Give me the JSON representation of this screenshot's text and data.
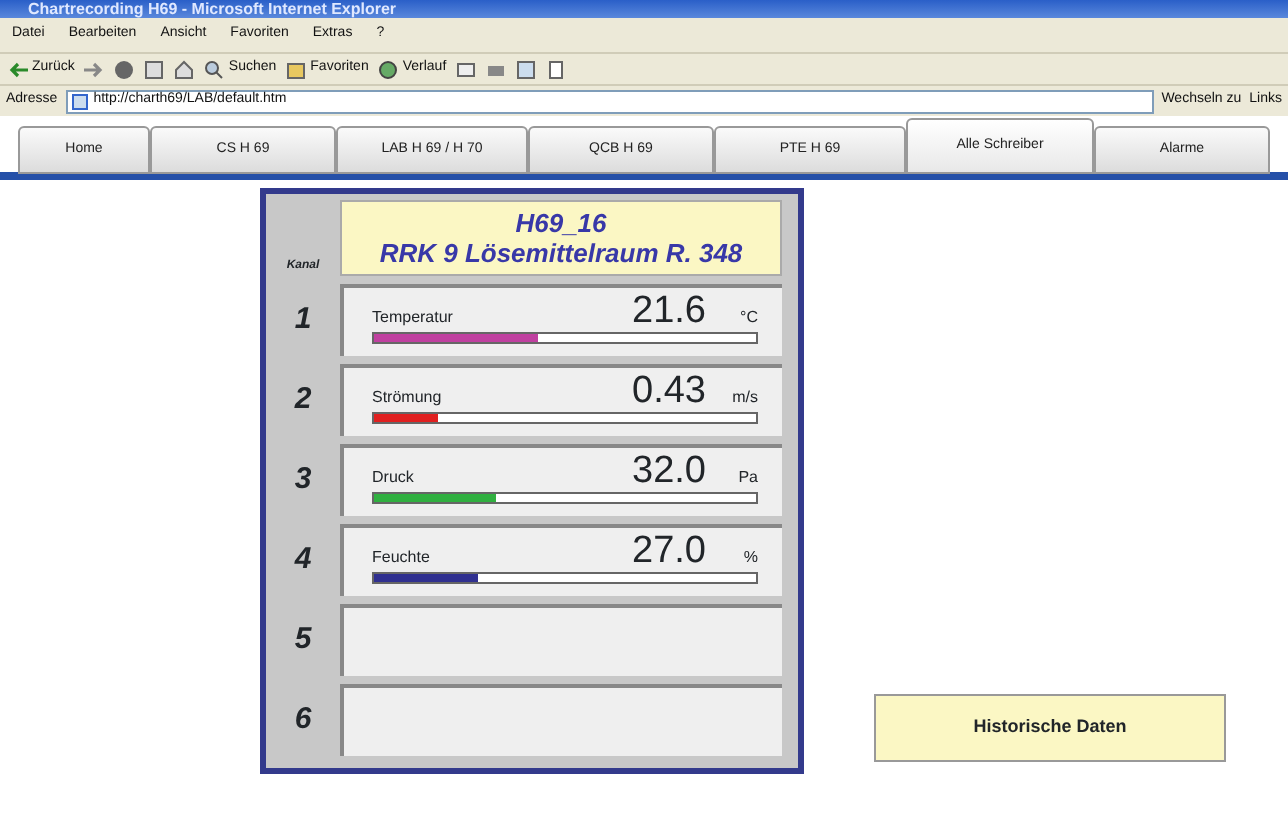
{
  "window": {
    "title": "Chartrecording H69 - Microsoft Internet Explorer"
  },
  "menu": [
    "Datei",
    "Bearbeiten",
    "Ansicht",
    "Favoriten",
    "Extras",
    "?"
  ],
  "toolbar": [
    {
      "kind": "back",
      "label": "Zurück"
    },
    {
      "kind": "forward"
    },
    {
      "kind": "stop"
    },
    {
      "kind": "refresh"
    },
    {
      "kind": "home"
    },
    {
      "kind": "search",
      "label": "Suchen"
    },
    {
      "kind": "favorites",
      "label": "Favoriten"
    },
    {
      "kind": "history",
      "label": "Verlauf"
    },
    {
      "kind": "mail"
    },
    {
      "kind": "print"
    },
    {
      "kind": "edit"
    },
    {
      "kind": "discuss"
    }
  ],
  "address": {
    "label": "Adresse",
    "value": "http://charth69/LAB/default.htm",
    "go": "Wechseln zu",
    "links": "Links"
  },
  "tabs": [
    {
      "label": "Home",
      "selected": false
    },
    {
      "label": "CS H 69",
      "selected": false
    },
    {
      "label": "LAB H 69 / H 70",
      "selected": false
    },
    {
      "label": "QCB H 69",
      "selected": false
    },
    {
      "label": "PTE H 69",
      "selected": false
    },
    {
      "label": "Alle Schreiber",
      "selected": true
    },
    {
      "label": "Alarme",
      "selected": false
    }
  ],
  "panel": {
    "title": "H69_16",
    "subtitle": "RRK 9 Lösemittelraum R. 348",
    "channel_label": "Kanal",
    "channels": [
      {
        "number": "1",
        "name": "Temperatur",
        "value": "21.6",
        "unit": "°C",
        "level": 0.43,
        "color": "#c040a0"
      },
      {
        "number": "2",
        "name": "Strömung",
        "value": "0.43",
        "unit": "m/s",
        "level": 0.17,
        "color": "#e02020"
      },
      {
        "number": "3",
        "name": "Druck",
        "value": "32.0",
        "unit": "Pa",
        "level": 0.32,
        "color": "#30b040"
      },
      {
        "number": "4",
        "name": "Feuchte",
        "value": "27.0",
        "unit": "%",
        "level": 0.27,
        "color": "#303090"
      },
      {
        "number": "5"
      },
      {
        "number": "6"
      }
    ]
  },
  "history_button": "Historische Daten"
}
